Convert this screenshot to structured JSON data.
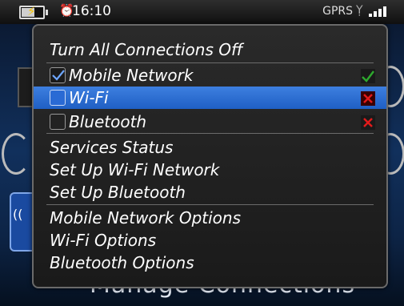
{
  "status_bar": {
    "time": "16:10",
    "network": "GPRS",
    "alarm_icon": "alarm-clock-icon",
    "battery_icon": "battery-charging-icon",
    "signal_icon": "signal-strength-icon"
  },
  "background": {
    "title": "Manage Connections"
  },
  "menu": {
    "items": [
      {
        "label": "Turn All Connections Off"
      },
      {
        "label": "Mobile Network",
        "checked": true,
        "status": "on"
      },
      {
        "label": "Wi-Fi",
        "checked": false,
        "status": "off"
      },
      {
        "label": "Bluetooth",
        "checked": false,
        "status": "off"
      },
      {
        "label": "Services Status"
      },
      {
        "label": "Set Up Wi-Fi Network"
      },
      {
        "label": "Set Up Bluetooth"
      },
      {
        "label": "Mobile Network Options"
      },
      {
        "label": "Wi-Fi Options"
      },
      {
        "label": "Bluetooth Options"
      }
    ]
  },
  "colors": {
    "highlight": "#2f6fd8",
    "check_on": "#2ea82e",
    "check_off": "#e01b1b",
    "menu_bg": "#222222"
  }
}
